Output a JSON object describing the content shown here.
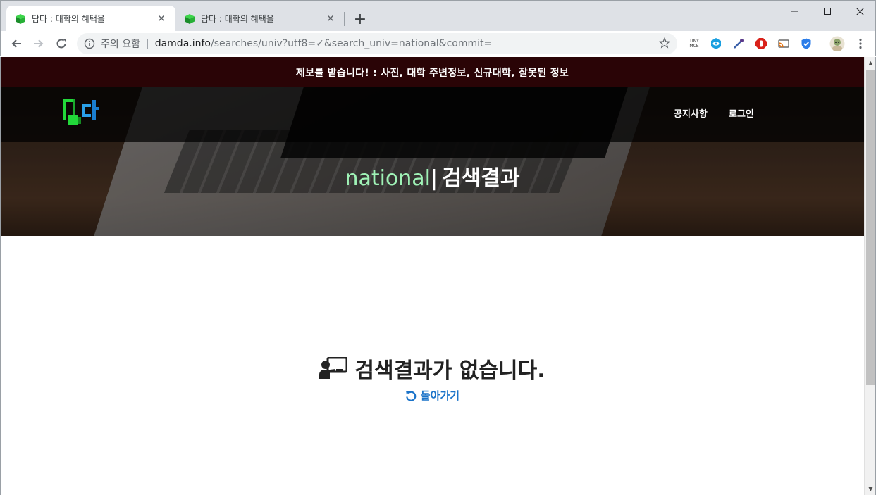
{
  "browser": {
    "tabs": [
      {
        "title": "담다 : 대학의 혜택을",
        "active": true
      },
      {
        "title": "담다 : 대학의 혜택을",
        "active": false
      }
    ],
    "security_label": "주의 요함",
    "url_host": "damda.info",
    "url_path": "/searches/univ?utf8=✓&search_univ=national&commit=",
    "extension_icons": [
      "tinymce-icon",
      "eye-icon",
      "dropper-icon",
      "hand-stop-icon",
      "cast-icon",
      "shield-check-icon",
      "avatar-icon"
    ],
    "tinymce_label": "TINY MCE"
  },
  "page": {
    "announcement": "제보를 받습니다! : 사진, 대학 주변정보, 신규대학, 잘못된 정보",
    "nav": {
      "logo_text": "담다",
      "notice": "공지사항",
      "login": "로그인"
    },
    "hero": {
      "keyword": "national",
      "separator": "|",
      "suffix": "검색결과"
    },
    "empty_message": "검색결과가 없습니다.",
    "back_link": "돌아가기"
  },
  "colors": {
    "announcement_bg": "#2a0406",
    "keyword": "#9ff2b6",
    "link": "#1a73c9"
  }
}
